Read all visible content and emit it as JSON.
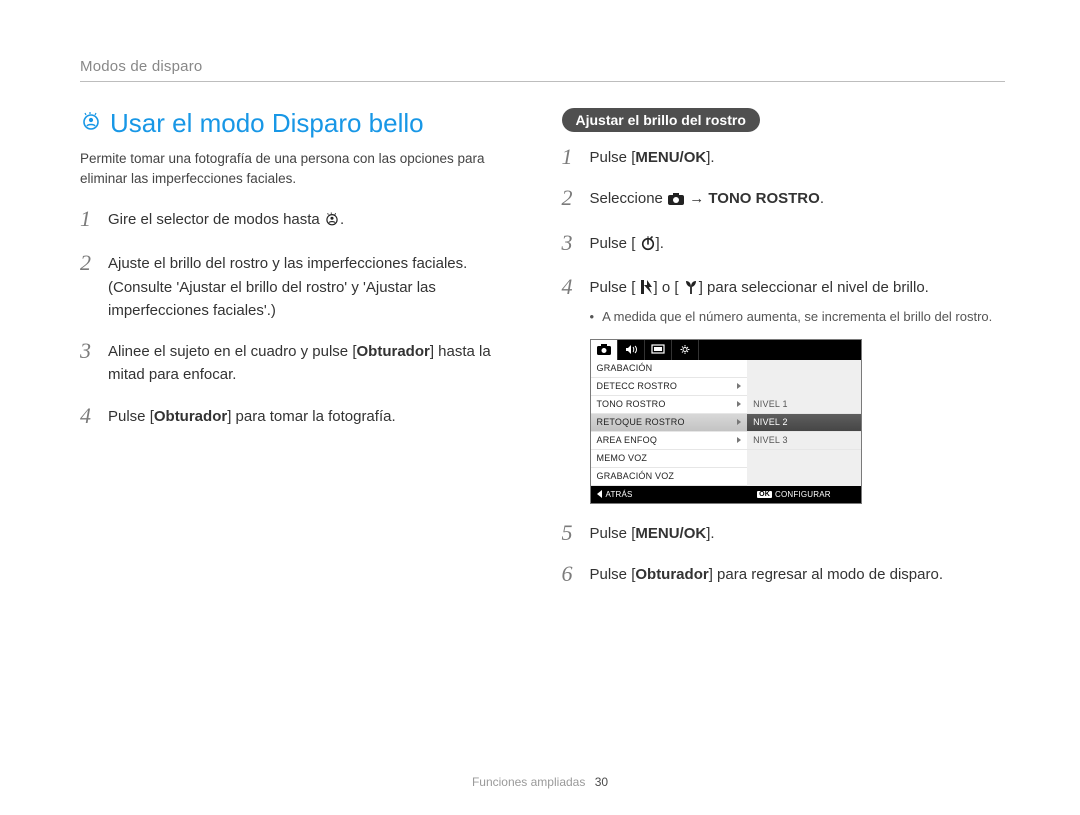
{
  "breadcrumb": "Modos de disparo",
  "title": "Usar el modo Disparo bello",
  "intro": "Permite tomar una fotografía de una persona con las opciones para eliminar las imperfecciones faciales.",
  "left_steps": [
    {
      "n": "1",
      "pre": "Gire el selector de modos hasta ",
      "post": ".",
      "icon": "beauty-dial-icon"
    },
    {
      "n": "2",
      "text": "Ajuste el brillo del rostro y las imperfecciones faciales. (Consulte 'Ajustar el brillo del rostro' y 'Ajustar las imperfecciones faciales'.)"
    },
    {
      "n": "3",
      "pre": "Alinee el sujeto en el cuadro y pulse [",
      "bold": "Obturador",
      "post": "] hasta la mitad para enfocar."
    },
    {
      "n": "4",
      "pre": "Pulse [",
      "bold": "Obturador",
      "post": "] para tomar la fotografía."
    }
  ],
  "right": {
    "pill": "Ajustar el brillo del rostro",
    "steps_top": [
      {
        "n": "1",
        "pre": "Pulse [",
        "bold": "MENU/OK",
        "post": "]."
      },
      {
        "n": "2",
        "pre": "Seleccione ",
        "icon": "camera-icon",
        "mid": " → ",
        "bold": "TONO ROSTRO",
        "post": "."
      },
      {
        "n": "3",
        "pre": "Pulse [",
        "icon": "timer-icon",
        "post": "]."
      },
      {
        "n": "4",
        "pre": "Pulse [",
        "icon": "flash-icon",
        "mid": "] o [",
        "icon2": "macro-icon",
        "post": "] para seleccionar el nivel de brillo."
      }
    ],
    "bullet": "A medida que el número aumenta, se incrementa el brillo del rostro.",
    "steps_bottom": [
      {
        "n": "5",
        "pre": "Pulse [",
        "bold": "MENU/OK",
        "post": "]."
      },
      {
        "n": "6",
        "pre": "Pulse [",
        "bold": "Obturador",
        "post": "] para regresar al modo de disparo."
      }
    ]
  },
  "mock": {
    "menu": [
      "GRABACIÓN",
      "DETECC ROSTRO",
      "TONO ROSTRO",
      "RETOQUE ROSTRO",
      "AREA ENFOQ",
      "MEMO VOZ",
      "GRABACIÓN VOZ"
    ],
    "menu_selected_index": 3,
    "menu_arrow_indices": [
      1,
      2,
      3,
      4
    ],
    "sub": [
      "NIVEL 1",
      "NIVEL 2",
      "NIVEL 3"
    ],
    "sub_selected_index": 1,
    "foot_left": "ATRÁS",
    "foot_right": "CONFIGURAR",
    "foot_ok": "OK"
  },
  "footer": {
    "section": "Funciones ampliadas",
    "page": "30"
  }
}
